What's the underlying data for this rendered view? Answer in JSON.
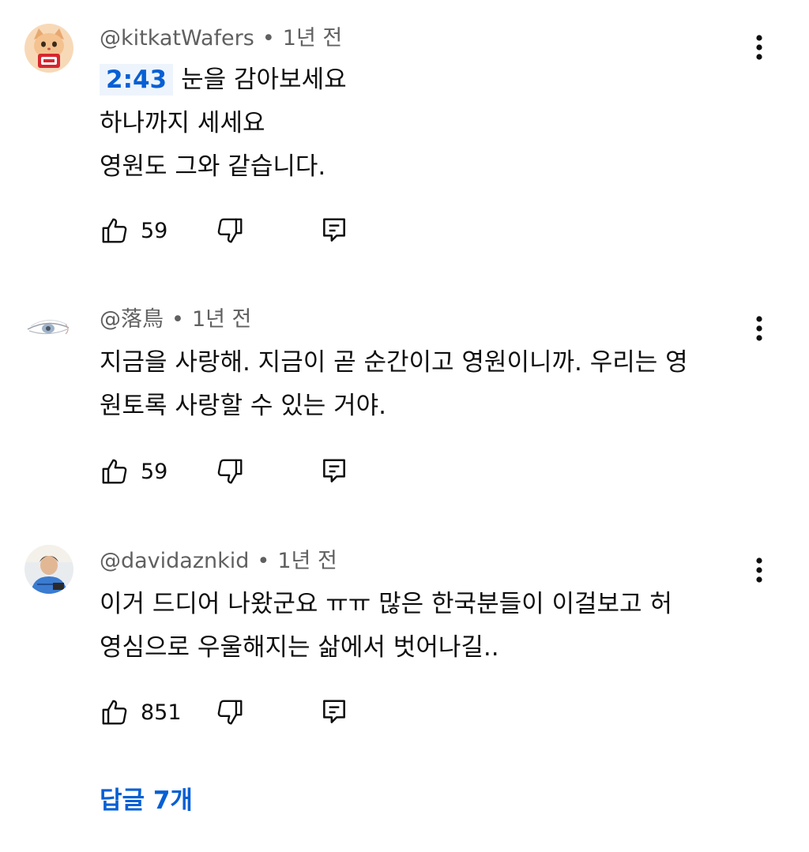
{
  "comments": [
    {
      "author": "@kitkatWafers",
      "separator": "•",
      "time": "1년 전",
      "timestamp_link": "2:43",
      "lines": [
        "눈을 감아보세요",
        "하나까지 세세요",
        "영원도 그와 같습니다."
      ],
      "likes": "59",
      "avatar_icon": "cat-avatar-icon"
    },
    {
      "author": "@落鳥",
      "separator": "•",
      "time": "1년 전",
      "lines": [
        "지금을 사랑해. 지금이 곧 순간이고 영원이니까. 우리는 영",
        "원토록 사랑할 수 있는 거야."
      ],
      "likes": "59",
      "avatar_icon": "eye-sketch-avatar-icon"
    },
    {
      "author": "@davidaznkid",
      "separator": "•",
      "time": "1년 전",
      "lines": [
        "이거 드디어 나왔군요 ㅠㅠ 많은 한국분들이 이걸보고 허",
        "영심으로 우울해지는 삶에서 벗어나길.."
      ],
      "likes": "851",
      "avatar_icon": "person-photo-avatar-icon"
    }
  ],
  "replies_label": "답글 7개",
  "colors": {
    "link_blue": "#065fd4",
    "secondary_text": "#606060",
    "primary_text": "#0f0f0f",
    "timestamp_bg": "#eef4fc"
  }
}
